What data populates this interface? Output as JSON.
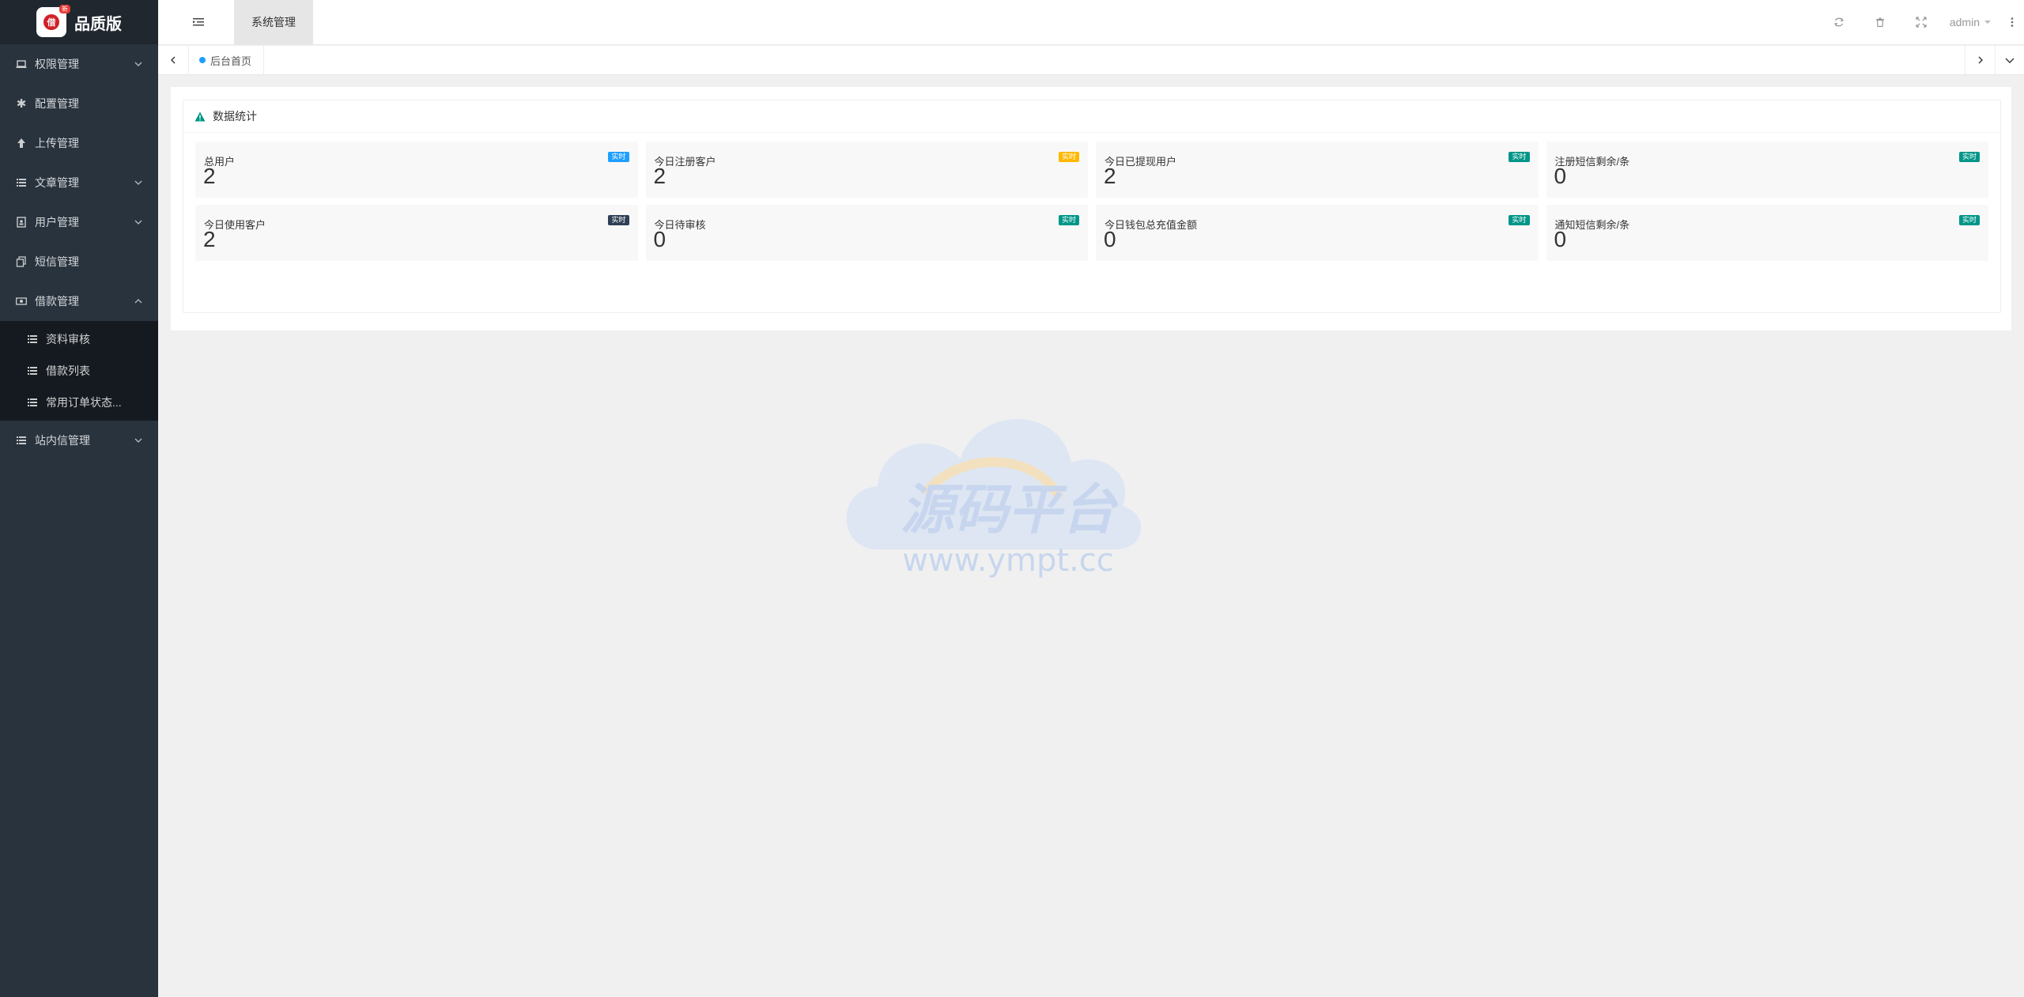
{
  "logo": {
    "text": "品质版",
    "badge": "新",
    "mark": "借"
  },
  "sidebar": {
    "items": [
      {
        "label": "权限管理",
        "icon": "laptop-icon",
        "arrow": "down"
      },
      {
        "label": "配置管理",
        "icon": "asterisk-icon",
        "arrow": ""
      },
      {
        "label": "上传管理",
        "icon": "upload-arrow-icon",
        "arrow": ""
      },
      {
        "label": "文章管理",
        "icon": "list-icon",
        "arrow": "down"
      },
      {
        "label": "用户管理",
        "icon": "user-card-icon",
        "arrow": "down"
      },
      {
        "label": "短信管理",
        "icon": "copy-icon",
        "arrow": ""
      },
      {
        "label": "借款管理",
        "icon": "money-icon",
        "arrow": "up"
      }
    ],
    "subitems": [
      {
        "label": "资料审核"
      },
      {
        "label": "借款列表"
      },
      {
        "label": "常用订单状态..."
      }
    ],
    "after": {
      "label": "站内信管理",
      "icon": "list-icon",
      "arrow": "down"
    }
  },
  "header": {
    "system_tab": "系统管理",
    "user": "admin"
  },
  "tabs": {
    "home": "后台首页"
  },
  "card": {
    "title": "数据统计",
    "stats": [
      {
        "title": "总用户",
        "value": "2",
        "badge": "实时",
        "badge_color": "#1e9fff"
      },
      {
        "title": "今日注册客户",
        "value": "2",
        "badge": "实时",
        "badge_color": "#ffb800"
      },
      {
        "title": "今日已提现用户",
        "value": "2",
        "badge": "实时",
        "badge_color": "#009688"
      },
      {
        "title": "注册短信剩余/条",
        "value": "0",
        "badge": "实时",
        "badge_color": "#009688"
      },
      {
        "title": "今日使用客户",
        "value": "2",
        "badge": "实时",
        "badge_color": "#2f4056"
      },
      {
        "title": "今日待审核",
        "value": "0",
        "badge": "实时",
        "badge_color": "#009688"
      },
      {
        "title": "今日钱包总充值金额",
        "value": "0",
        "badge": "实时",
        "badge_color": "#009688"
      },
      {
        "title": "通知短信剩余/条",
        "value": "0",
        "badge": "实时",
        "badge_color": "#009688"
      }
    ]
  },
  "watermark": {
    "title": "源码平台",
    "url": "www.ympt.cc"
  },
  "colors": {
    "sidebar": "#28333e",
    "submenu": "#151a20",
    "accent": "#009688"
  }
}
